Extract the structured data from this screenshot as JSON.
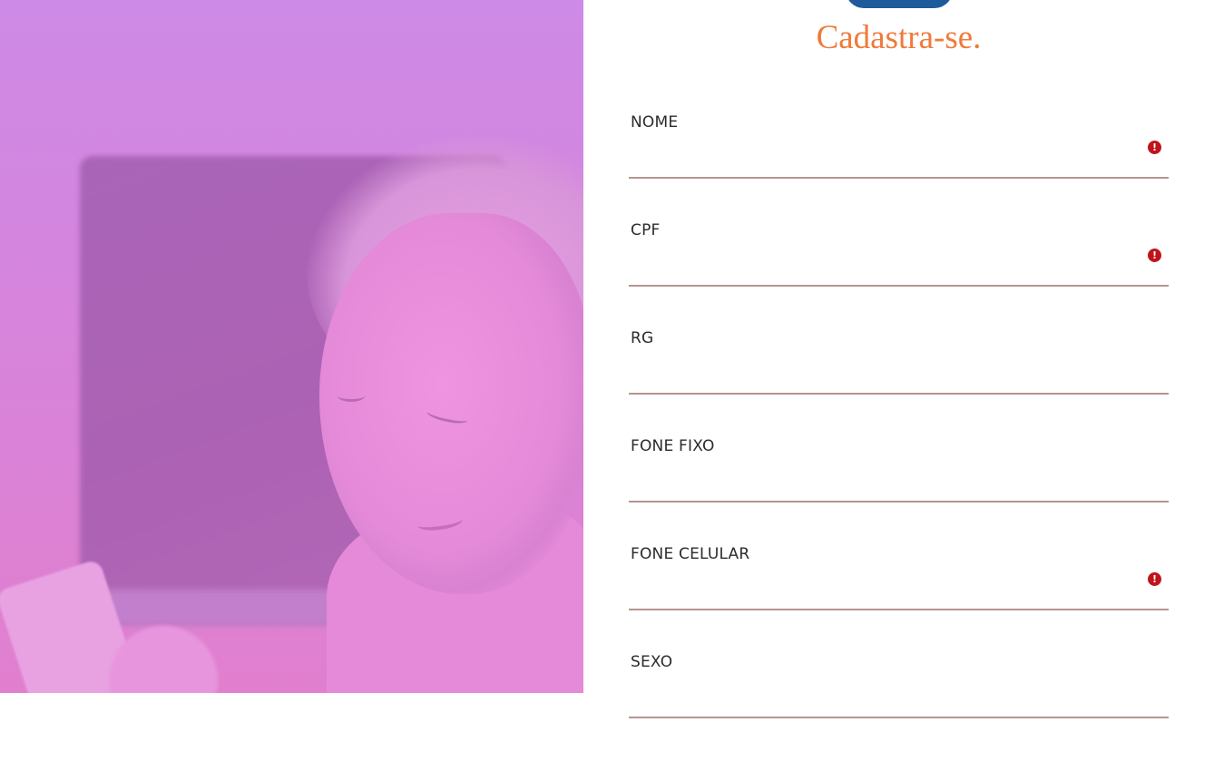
{
  "form": {
    "title": "Cadastra-se.",
    "fields": [
      {
        "label": "NOME",
        "value": "",
        "error": true
      },
      {
        "label": "CPF",
        "value": "",
        "error": true
      },
      {
        "label": "RG",
        "value": "",
        "error": false
      },
      {
        "label": "FONE FIXO",
        "value": "",
        "error": false
      },
      {
        "label": "FONE CELULAR",
        "value": "",
        "error": true
      },
      {
        "label": "SEXO",
        "value": "",
        "error": false
      }
    ],
    "error_icon": "exclamation-circle-icon"
  },
  "colors": {
    "title": "#f07a3a",
    "underline": "#b5958e",
    "error": "#c0141c",
    "top_button": "#1e5a9c",
    "hero_overlay": "#d684dc"
  }
}
